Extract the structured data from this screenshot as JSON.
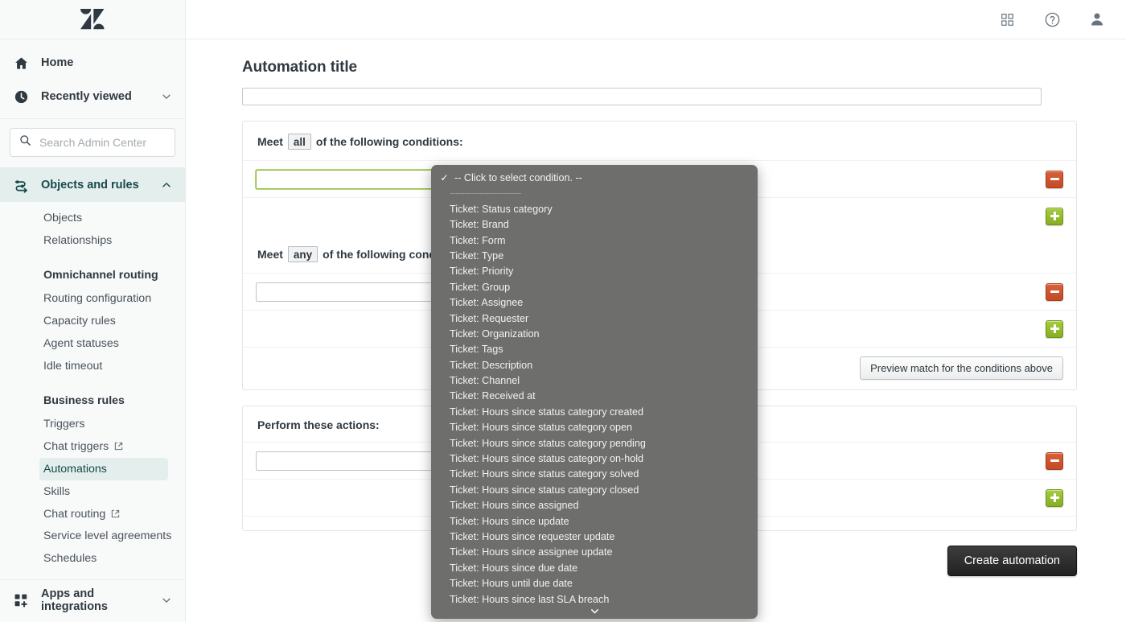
{
  "sidebar": {
    "logo_name": "zendesk-logo",
    "top_items": [
      {
        "label": "Home",
        "icon": "home-icon",
        "chevron": false
      },
      {
        "label": "Recently viewed",
        "icon": "clock-icon",
        "chevron": true
      }
    ],
    "search": {
      "placeholder": "Search Admin Center",
      "value": ""
    },
    "active_section": {
      "label": "Objects and rules",
      "icon": "objects-rules-icon",
      "chevron": true
    },
    "sub_items": [
      {
        "label": "Objects",
        "type": "item"
      },
      {
        "label": "Relationships",
        "type": "item"
      },
      {
        "label": "Omnichannel routing",
        "type": "head"
      },
      {
        "label": "Routing configuration",
        "type": "item"
      },
      {
        "label": "Capacity rules",
        "type": "item"
      },
      {
        "label": "Agent statuses",
        "type": "item"
      },
      {
        "label": "Idle timeout",
        "type": "item"
      },
      {
        "label": "Business rules",
        "type": "head"
      },
      {
        "label": "Triggers",
        "type": "item"
      },
      {
        "label": "Chat triggers",
        "type": "item",
        "external": true
      },
      {
        "label": "Automations",
        "type": "item",
        "selected": true
      },
      {
        "label": "Skills",
        "type": "item"
      },
      {
        "label": "Chat routing",
        "type": "item",
        "external": true
      },
      {
        "label": "Service level agreements",
        "type": "item",
        "twoline": true
      },
      {
        "label": "Schedules",
        "type": "item"
      }
    ],
    "bottom_item": {
      "label": "Apps and integrations",
      "icon": "apps-icon",
      "chevron": true
    }
  },
  "topbar": {
    "icons": [
      {
        "name": "products-grid-icon"
      },
      {
        "name": "help-circle-icon"
      },
      {
        "name": "user-avatar-icon"
      }
    ]
  },
  "main": {
    "page_title": "Automation title",
    "title_input_value": "",
    "conditions_all": {
      "prefix": "Meet",
      "selector_value": "all",
      "suffix": "of the following conditions:"
    },
    "conditions_any": {
      "prefix": "Meet",
      "selector_value": "any",
      "suffix": "of the following conditions:"
    },
    "actions_heading": "Perform these actions:",
    "preview_button": "Preview match for the conditions above",
    "create_button": "Create automation"
  },
  "dropdown": {
    "first_option": "-- Click to select condition. --",
    "separator": "------------------------",
    "options": [
      "Ticket: Status category",
      "Ticket: Brand",
      "Ticket: Form",
      "Ticket: Type",
      "Ticket: Priority",
      "Ticket: Group",
      "Ticket: Assignee",
      "Ticket: Requester",
      "Ticket: Organization",
      "Ticket: Tags",
      "Ticket: Description",
      "Ticket: Channel",
      "Ticket: Received at",
      "Ticket: Hours since status category created",
      "Ticket: Hours since status category open",
      "Ticket: Hours since status category pending",
      "Ticket: Hours since status category on-hold",
      "Ticket: Hours since status category solved",
      "Ticket: Hours since status category closed",
      "Ticket: Hours since assigned",
      "Ticket: Hours since update",
      "Ticket: Hours since requester update",
      "Ticket: Hours since assignee update",
      "Ticket: Hours since due date",
      "Ticket: Hours until due date",
      "Ticket: Hours since last SLA breach"
    ],
    "scroll_indicator": "chevron-down-icon"
  },
  "colors": {
    "sidebar_bg": "#f8f9f9",
    "active_nav": "#e4eeed",
    "active_nav_text": "#17494d",
    "dropdown_bg": "#6e6e6c",
    "remove_button": "#c24a26",
    "add_button": "#86ae24",
    "create_button": "#222222",
    "focus_green": "#8fbd3f"
  }
}
